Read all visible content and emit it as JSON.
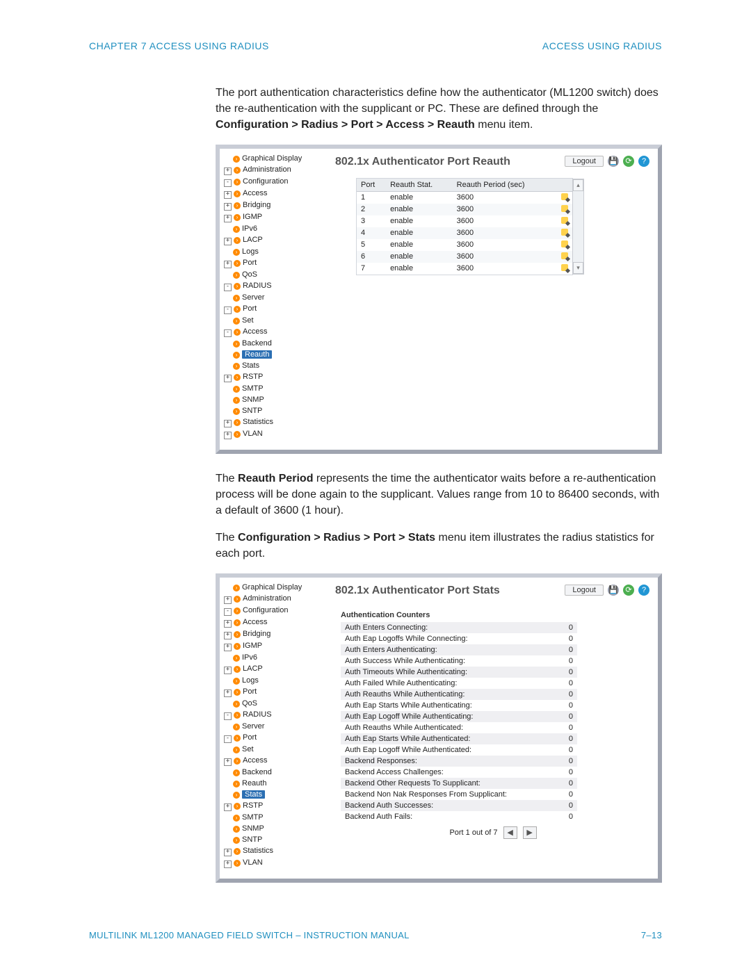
{
  "header": {
    "left": "CHAPTER 7  ACCESS USING RADIUS",
    "right": "ACCESS USING RADIUS"
  },
  "footer": {
    "left": "MULTILINK ML1200 MANAGED FIELD SWITCH – INSTRUCTION MANUAL",
    "right": "7–13"
  },
  "para1a": "The port authentication characteristics define how the authenticator (ML1200 switch) does the re-authentication with the supplicant or PC. These are defined through the ",
  "para1b": "Configuration > Radius > Port > Access > Reauth",
  "para1c": " menu item.",
  "para2a": "The ",
  "para2b": "Reauth Period",
  "para2c": " represents the time the authenticator waits before a re-authentication process will be done again to the supplicant. Values range from 10 to 86400 seconds, with a default of 3600 (1 hour).",
  "para3a": "The ",
  "para3b": "Configuration > Radius > Port > Stats",
  "para3c": " menu item illustrates the radius statistics for each port.",
  "logout": "Logout",
  "nav": {
    "top": "Graphical Display",
    "admin": "Administration",
    "config": "Configuration",
    "access": "Access",
    "bridging": "Bridging",
    "igmp": "IGMP",
    "ipv6": "IPv6",
    "lacp": "LACP",
    "logs": "Logs",
    "port": "Port",
    "qos": "QoS",
    "radius": "RADIUS",
    "server": "Server",
    "rport": "Port",
    "set": "Set",
    "raccess": "Access",
    "backend": "Backend",
    "reauth": "Reauth",
    "stats": "Stats",
    "rstp": "RSTP",
    "smtp": "SMTP",
    "snmp": "SNMP",
    "sntp": "SNTP",
    "statistics": "Statistics",
    "vlan": "VLAN"
  },
  "shot1": {
    "title": "802.1x Authenticator Port Reauth",
    "headers": {
      "port": "Port",
      "stat": "Reauth Stat.",
      "period": "Reauth Period (sec)"
    },
    "rows": [
      {
        "port": "1",
        "stat": "enable",
        "period": "3600"
      },
      {
        "port": "2",
        "stat": "enable",
        "period": "3600"
      },
      {
        "port": "3",
        "stat": "enable",
        "period": "3600"
      },
      {
        "port": "4",
        "stat": "enable",
        "period": "3600"
      },
      {
        "port": "5",
        "stat": "enable",
        "period": "3600"
      },
      {
        "port": "6",
        "stat": "enable",
        "period": "3600"
      },
      {
        "port": "7",
        "stat": "enable",
        "period": "3600"
      }
    ]
  },
  "shot2": {
    "title": "802.1x Authenticator Port Stats",
    "section": "Authentication Counters",
    "pager": "Port 1 out of 7",
    "rows": [
      {
        "l": "Auth Enters Connecting:",
        "v": "0"
      },
      {
        "l": "Auth Eap Logoffs While Connecting:",
        "v": "0"
      },
      {
        "l": "Auth Enters Authenticating:",
        "v": "0"
      },
      {
        "l": "Auth Success While Authenticating:",
        "v": "0"
      },
      {
        "l": "Auth Timeouts While Authenticating:",
        "v": "0"
      },
      {
        "l": "Auth Failed While Authenticating:",
        "v": "0"
      },
      {
        "l": "Auth Reauths While Authenticating:",
        "v": "0"
      },
      {
        "l": "Auth Eap Starts While Authenticating:",
        "v": "0"
      },
      {
        "l": "Auth Eap Logoff While Authenticating:",
        "v": "0"
      },
      {
        "l": "Auth Reauths While Authenticated:",
        "v": "0"
      },
      {
        "l": "Auth Eap Starts While Authenticated:",
        "v": "0"
      },
      {
        "l": "Auth Eap Logoff While Authenticated:",
        "v": "0"
      },
      {
        "l": "Backend Responses:",
        "v": "0"
      },
      {
        "l": "Backend Access Challenges:",
        "v": "0"
      },
      {
        "l": "Backend Other Requests To Supplicant:",
        "v": "0"
      },
      {
        "l": "Backend Non Nak Responses From Supplicant:",
        "v": "0"
      },
      {
        "l": "Backend Auth Successes:",
        "v": "0"
      },
      {
        "l": "Backend Auth Fails:",
        "v": "0"
      }
    ]
  }
}
